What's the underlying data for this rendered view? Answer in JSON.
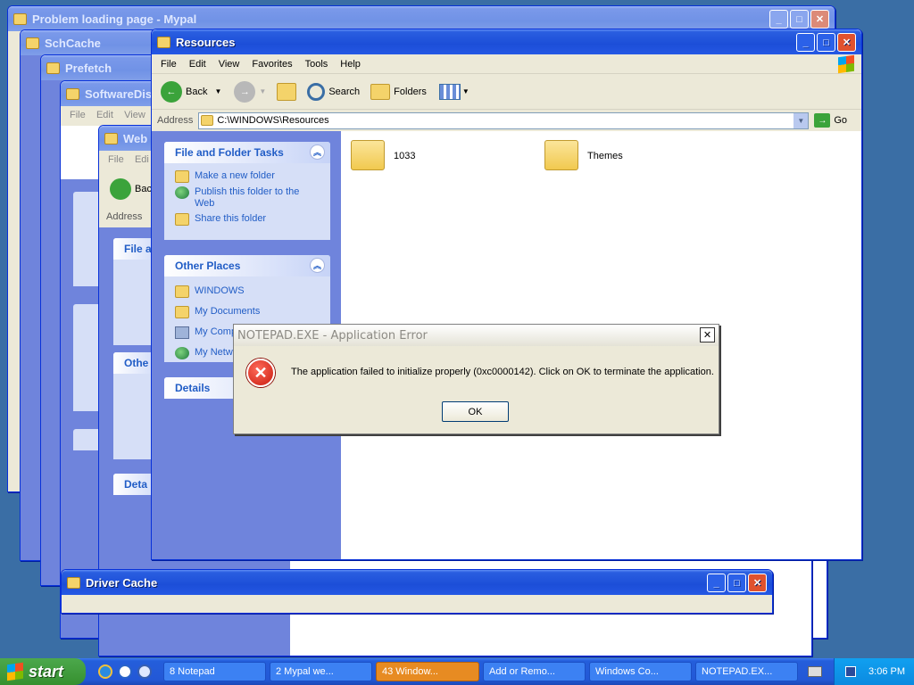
{
  "background_windows": [
    {
      "title": "Problem loading page - Mypal"
    },
    {
      "title": "SchCache"
    },
    {
      "title": "Prefetch"
    },
    {
      "title": "SoftwareDist"
    },
    {
      "title": "Web"
    },
    {
      "title": "Driver Cache"
    }
  ],
  "bg_fragments": {
    "back": "Bac",
    "address": "Address",
    "file_short": "File",
    "details": "Details",
    "other_short": "Othe",
    "deta": "Deta",
    "file_a": "File a"
  },
  "explorer": {
    "title": "Resources",
    "menu": [
      "File",
      "Edit",
      "View",
      "Favorites",
      "Tools",
      "Help"
    ],
    "toolbar": {
      "back": "Back",
      "search": "Search",
      "folders": "Folders"
    },
    "address_label": "Address",
    "address_value": "C:\\WINDOWS\\Resources",
    "go": "Go",
    "tasks": {
      "title": "File and Folder Tasks",
      "items": [
        "Make a new folder",
        "Publish this folder to the Web",
        "Share this folder"
      ]
    },
    "other_places": {
      "title": "Other Places",
      "items": [
        "WINDOWS",
        "My Documents",
        "My Comp",
        "My Netw"
      ]
    },
    "details": {
      "title": "Details"
    },
    "files": [
      {
        "name": "1033"
      },
      {
        "name": "Themes"
      }
    ]
  },
  "dialog": {
    "title": "NOTEPAD.EXE - Application Error",
    "message": "The application failed to initialize properly (0xc0000142). Click on OK to terminate the application.",
    "ok": "OK"
  },
  "taskbar": {
    "start": "start",
    "items": [
      "8 Notepad",
      "2 Mypal we...",
      "43 Window...",
      "Add or Remo...",
      "Windows Co...",
      "NOTEPAD.EX..."
    ],
    "clock": "3:06 PM"
  }
}
